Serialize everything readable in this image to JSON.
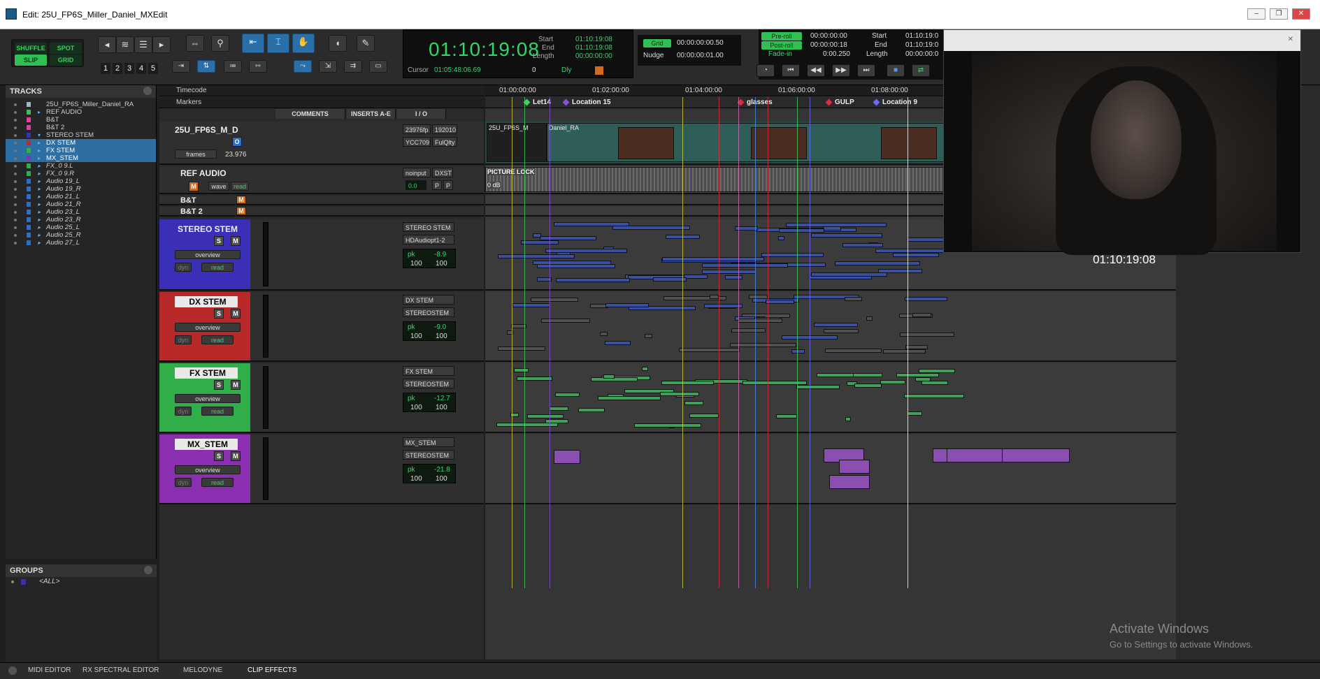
{
  "window": {
    "title": "Edit: 25U_FP6S_Miller_Daniel_MXEdit"
  },
  "edit_modes": {
    "shuffle": "SHUFFLE",
    "spot": "SPOT",
    "slip": "SLIP",
    "grid": "GRID"
  },
  "zoom_presets": [
    "1",
    "2",
    "3",
    "4",
    "5"
  ],
  "counter": {
    "main": "01:10:19:08",
    "start_label": "Start",
    "start": "01:10:19:08",
    "end_label": "End",
    "end": "01:10:19:08",
    "length_label": "Length",
    "length": "00:00:00:00",
    "cursor_label": "Cursor",
    "cursor": "01:05:48:06.69",
    "cursor_value": "0",
    "dly": "Dly"
  },
  "grid": {
    "grid_label": "Grid",
    "grid_value": "00:00:00:00.50",
    "nudge_label": "Nudge",
    "nudge_value": "00:00:00:01.00"
  },
  "preroll": {
    "preroll_label": "Pre-roll",
    "preroll": "00:00:00:00",
    "postroll_label": "Post-roll",
    "postroll": "00:00:00:18",
    "fadein_label": "Fade-in",
    "fadein": "0:00.250",
    "start_label": "Start",
    "start": "01:10:19:0",
    "end_label": "End",
    "end": "01:10:19:0",
    "length_label": "Length",
    "length": "00:00:00:0"
  },
  "tracks_panel": {
    "title": "TRACKS",
    "items": [
      {
        "label": "25U_FP6S_Miller_Daniel_RA",
        "color": "#9fb6c9",
        "sel": false,
        "fold": ""
      },
      {
        "label": "REF AUDIO",
        "color": "#3fbf5a",
        "sel": false,
        "fold": "▸"
      },
      {
        "label": "B&T",
        "color": "#e0409a",
        "sel": false,
        "fold": ""
      },
      {
        "label": "B&T 2",
        "color": "#e0409a",
        "sel": false,
        "fold": ""
      },
      {
        "label": "STEREO STEM",
        "color": "#3b2fb8",
        "sel": false,
        "fold": "▾"
      },
      {
        "label": "DX STEM",
        "color": "#c02a2a",
        "sel": true,
        "fold": "▸"
      },
      {
        "label": "FX STEM",
        "color": "#2fae4a",
        "sel": true,
        "fold": "▸"
      },
      {
        "label": "MX_STEM",
        "color": "#8a2fb0",
        "sel": true,
        "fold": "▸"
      },
      {
        "label": "FX_0 9.L",
        "color": "#2fae4a",
        "sel": false,
        "fold": "▸"
      },
      {
        "label": "FX_0 9.R",
        "color": "#2fae4a",
        "sel": false,
        "fold": "▸"
      },
      {
        "label": "Audio 19_L",
        "color": "#2a6fc9",
        "sel": false,
        "fold": "▸"
      },
      {
        "label": "Audio 19_R",
        "color": "#2a6fc9",
        "sel": false,
        "fold": "▸"
      },
      {
        "label": "Audio 21_L",
        "color": "#2a6fc9",
        "sel": false,
        "fold": "▸"
      },
      {
        "label": "Audio 21_R",
        "color": "#2a6fc9",
        "sel": false,
        "fold": "▸"
      },
      {
        "label": "Audio 23_L",
        "color": "#2a6fc9",
        "sel": false,
        "fold": "▸"
      },
      {
        "label": "Audio 23_R",
        "color": "#2a6fc9",
        "sel": false,
        "fold": "▸"
      },
      {
        "label": "Audio 25_L",
        "color": "#2a6fc9",
        "sel": false,
        "fold": "▸"
      },
      {
        "label": "Audio 25_R",
        "color": "#2a6fc9",
        "sel": false,
        "fold": "▸"
      },
      {
        "label": "Audio 27_L",
        "color": "#2a6fc9",
        "sel": false,
        "fold": "▸"
      }
    ]
  },
  "groups_panel": {
    "title": "GROUPS",
    "all": "<ALL>"
  },
  "ruler": {
    "timecode_label": "Timecode",
    "markers_label": "Markers",
    "ticks": [
      "01:00:00:00",
      "01:02:00:00",
      "01:04:00:00",
      "01:06:00:00",
      "01:08:00:00"
    ]
  },
  "columns": {
    "comments": "COMMENTS",
    "inserts": "INSERTS A-E",
    "io": "I / O"
  },
  "markers": [
    {
      "label": "Let14",
      "color": "#3fd45a"
    },
    {
      "label": "Location 15",
      "color": "#8a4fe0"
    },
    {
      "label": "glasses",
      "color": "#e02a3a"
    },
    {
      "label": "GULP",
      "color": "#e02a3a"
    },
    {
      "label": "Location 9",
      "color": "#6a6aff"
    }
  ],
  "video_track": {
    "name": "25U_FP6S_M_D",
    "rate": "23976fp",
    "res": "192010",
    "cs": "YCC709",
    "quality": "FulQlty",
    "frames_label": "frames",
    "fps": "23.976",
    "clip1": "25U_FP6S_M",
    "clip2": "Daniel_RA"
  },
  "ref_audio": {
    "name": "REF AUDIO",
    "wave": "wave",
    "read": "read",
    "input": "noinput",
    "output": "DXST",
    "vol": "0.0",
    "p1": "P",
    "p2": "P",
    "clip": "PICTURE LOCK",
    "db": "0 dB"
  },
  "bt_tracks": [
    {
      "name": "B&T"
    },
    {
      "name": "B&T 2"
    }
  ],
  "stems": [
    {
      "key": "stereo",
      "name": "STEREO STEM",
      "in": "STEREO STEM",
      "out": "HDAudiopt1-2",
      "pk_label": "pk",
      "pk": "-8.9",
      "vol_l": "100",
      "vol_r": "100",
      "view": "overview",
      "dyn": "dyn",
      "read": "read",
      "color": "#3b2fb8"
    },
    {
      "key": "dx",
      "name": "DX STEM",
      "in": "DX STEM",
      "out": "STEREOSTEM",
      "pk_label": "pk",
      "pk": "-9.0",
      "vol_l": "100",
      "vol_r": "100",
      "view": "overview",
      "dyn": "dyn",
      "read": "read",
      "color": "#b82a2a"
    },
    {
      "key": "fx",
      "name": "FX STEM",
      "in": "FX STEM",
      "out": "STEREOSTEM",
      "pk_label": "pk",
      "pk": "-12.7",
      "vol_l": "100",
      "vol_r": "100",
      "view": "overview",
      "dyn": "dyn",
      "read": "read",
      "color": "#2fae4a"
    },
    {
      "key": "mx",
      "name": "MX_STEM",
      "in": "MX_STEM",
      "out": "STEREOSTEM",
      "pk_label": "pk",
      "pk": "-21.8",
      "vol_l": "100",
      "vol_r": "100",
      "view": "overview",
      "dyn": "dyn",
      "read": "read",
      "color": "#8a2fb0"
    }
  ],
  "video_window": {
    "timecode": "01:10:19:08"
  },
  "watermark": {
    "line1": "Activate Windows",
    "line2": "Go to Settings to activate Windows."
  },
  "bottom_tabs": [
    "MIDI EDITOR",
    "RX SPECTRAL EDITOR",
    "MELODYNE",
    "CLIP EFFECTS"
  ]
}
